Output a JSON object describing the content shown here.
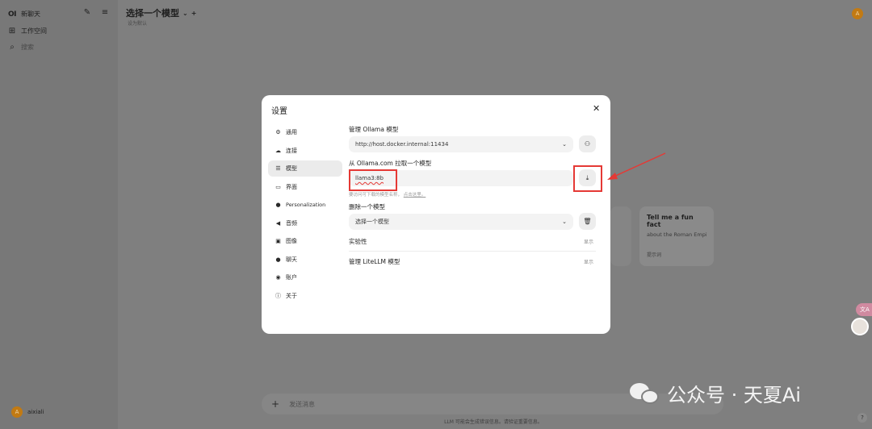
{
  "sidebar": {
    "logo": "OI",
    "new_chat": "新聊天",
    "workspace": "工作空间",
    "search": "搜索",
    "user_initial": "A",
    "user_name": "aixiali"
  },
  "header": {
    "model_title": "选择一个模型",
    "set_default": "设为默认",
    "avatar_initial": "A"
  },
  "suggestion": {
    "title": "Tell me a fun fact",
    "subtitle": "about the Roman Empi",
    "hint": "提示词"
  },
  "chat": {
    "placeholder": "发送消息",
    "disclaimer": "LLM 可能会生成错误信息。请验证重要信息。"
  },
  "watermark": {
    "text": "公众号 · 天夏Ai"
  },
  "side": {
    "pill": "文A"
  },
  "modal": {
    "title": "设置",
    "tabs": [
      {
        "label": "通用",
        "icon": "gear-icon"
      },
      {
        "label": "连接",
        "icon": "cloud-icon"
      },
      {
        "label": "模型",
        "icon": "database-icon"
      },
      {
        "label": "界面",
        "icon": "monitor-icon"
      },
      {
        "label": "Personalization",
        "icon": "user-icon"
      },
      {
        "label": "音频",
        "icon": "speaker-icon"
      },
      {
        "label": "图像",
        "icon": "image-icon"
      },
      {
        "label": "聊天",
        "icon": "chat-icon"
      },
      {
        "label": "账户",
        "icon": "account-icon"
      },
      {
        "label": "关于",
        "icon": "info-icon"
      }
    ],
    "active_tab": "模型",
    "manage_ollama": "管理 Ollama 模型",
    "ollama_url": "http://host.docker.internal:11434",
    "pull_label": "从 Ollama.com 拉取一个模型",
    "pull_value": "llama3:8b",
    "pull_hint": "要访问可下载的模型名称，",
    "pull_hint_link": "点击这里。",
    "delete_label": "删除一个模型",
    "delete_select": "选择一个模型",
    "experimental": "实验性",
    "experimental_action": "显示",
    "manage_litellm": "管理 LiteLLM 模型",
    "litellm_action": "显示"
  },
  "colors": {
    "annotation_red": "#e53935",
    "avatar_orange": "#c27a13"
  }
}
